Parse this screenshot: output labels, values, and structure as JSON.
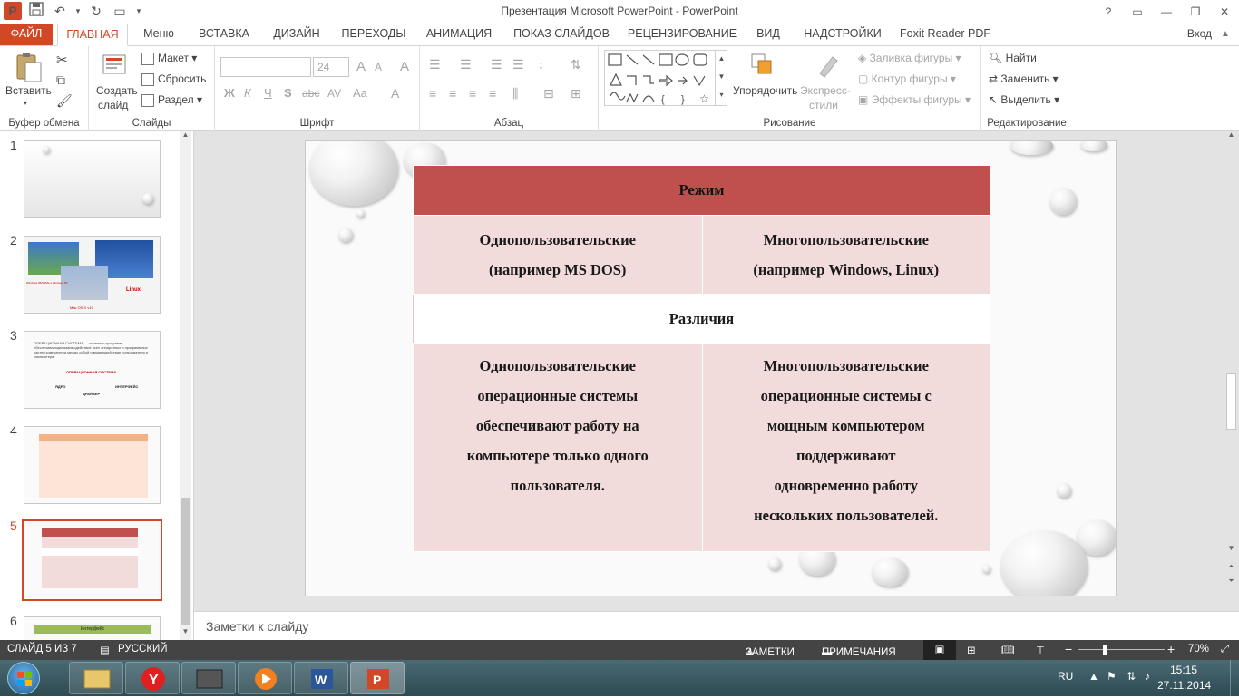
{
  "window": {
    "title": "Презентация Microsoft PowerPoint - PowerPoint",
    "help": "?",
    "login": "Вход"
  },
  "tabs": [
    "ФАЙЛ",
    "ГЛАВНАЯ",
    "Меню",
    "ВСТАВКА",
    "ДИЗАЙН",
    "ПЕРЕХОДЫ",
    "АНИМАЦИЯ",
    "ПОКАЗ СЛАЙДОВ",
    "РЕЦЕНЗИРОВАНИЕ",
    "ВИД",
    "НАДСТРОЙКИ",
    "Foxit Reader PDF"
  ],
  "ribbon": {
    "clipboard": {
      "paste": "Вставить",
      "label": "Буфер обмена"
    },
    "slides": {
      "create_line1": "Создать",
      "create_line2": "слайд",
      "layout": "Макет",
      "reset": "Сбросить",
      "section": "Раздел",
      "label": "Слайды"
    },
    "font": {
      "size": "24",
      "bold": "Ж",
      "italic": "К",
      "underline": "Ч",
      "strike": "S",
      "spacing": "abc",
      "av": "AV",
      "case": "Aa",
      "color": "A",
      "grow": "A",
      "shrink": "A",
      "clear": "A",
      "label": "Шрифт"
    },
    "paragraph": {
      "label": "Абзац"
    },
    "drawing": {
      "arrange": "Упорядочить",
      "styles_line1": "Экспресс-",
      "styles_line2": "стили",
      "fill": "Заливка фигуры",
      "outline": "Контур фигуры",
      "effects": "Эффекты фигуры",
      "label": "Рисование"
    },
    "editing": {
      "find": "Найти",
      "replace": "Заменить",
      "select": "Выделить",
      "label": "Редактирование"
    }
  },
  "thumbnails": {
    "numbers": [
      "1",
      "2",
      "3",
      "4",
      "5",
      "6"
    ],
    "selected": "5",
    "slide2": {
      "linux": "Linux",
      "left_caption": "Windows 95/98/Me и Windows NT",
      "bottom_caption": "Mac OS X v10"
    },
    "slide3": {
      "text": "ОПЕРАЦИОННАЯ СИСТЕМА — комплекс программ, обеспечивающих взаимодействие всех аппаратных и программных частей компьютера между собой и взаимодействие пользователя и компьютера.",
      "center": "ОПЕРАЦИОННАЯ СИСТЕМА",
      "core": "ЯДРО",
      "drivers": "ДРАЙВЕР",
      "interface": "ИНТЕРФЕЙС"
    },
    "slide6": {
      "title": "Интерфейс"
    }
  },
  "slide": {
    "mode_header": "Режим",
    "single_title": "Однопользовательские",
    "single_example": "(например MS DOS)",
    "multi_title": "Многопользовательские",
    "multi_example": "(например Windows, Linux)",
    "diff_header": "Различия",
    "single_desc": [
      "Однопользовательские",
      "операционные системы",
      "обеспечивают работу на",
      "компьютере только одного",
      "пользователя."
    ],
    "multi_desc": [
      "Многопользовательские",
      "операционные системы с",
      "мощным компьютером",
      "поддерживают",
      "одновременно работу",
      "нескольких пользователей."
    ]
  },
  "notes_placeholder": "Заметки к слайду",
  "status": {
    "slide_counter": "СЛАЙД 5 ИЗ 7",
    "language": "РУССКИЙ",
    "notes": "ЗАМЕТКИ",
    "comments": "ПРИМЕЧАНИЯ",
    "zoom_minus": "−",
    "zoom_plus": "+",
    "zoom": "70%"
  },
  "taskbar": {
    "lang": "RU",
    "time": "15:15",
    "date": "27.11.2014"
  },
  "colors": {
    "accent": "#d24726",
    "table_header": "#c0504d",
    "table_light": "#f2dcdb",
    "status_bg": "#444444"
  }
}
